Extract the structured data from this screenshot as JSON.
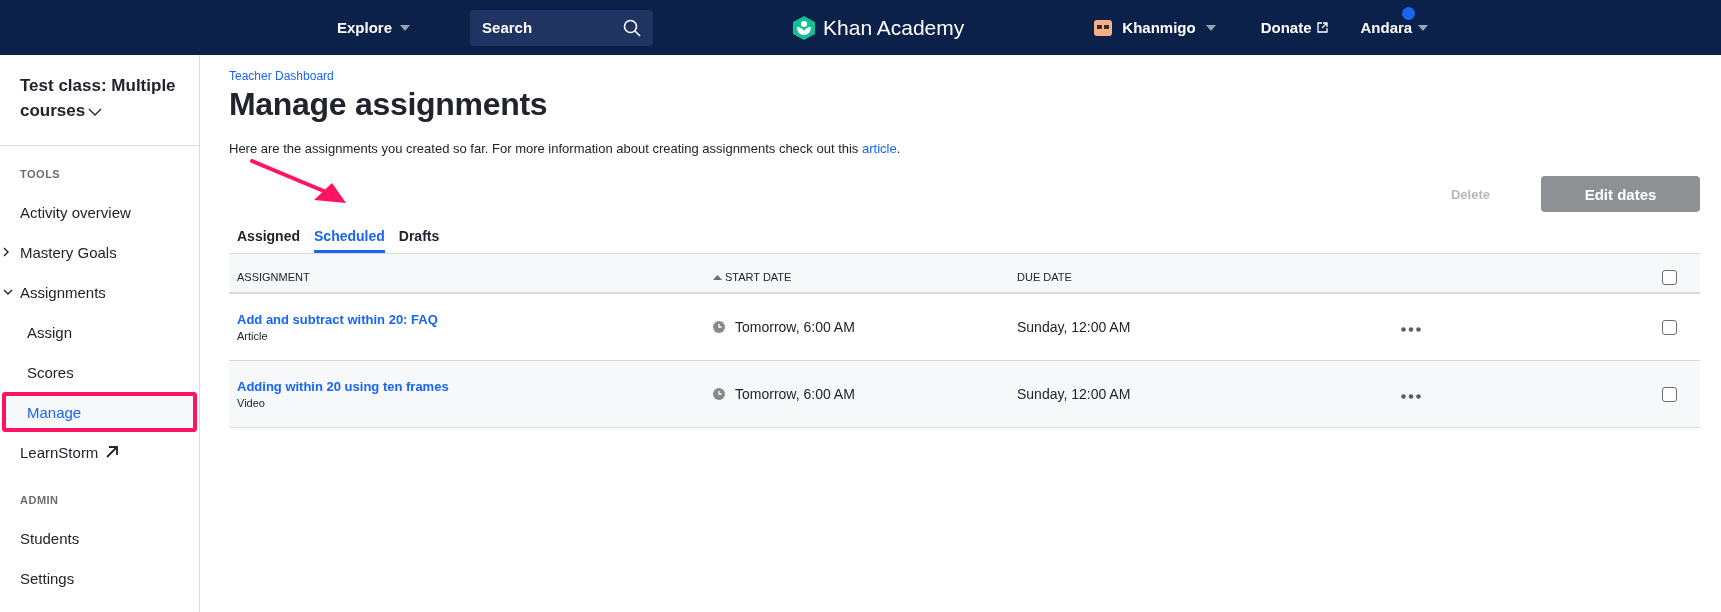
{
  "header": {
    "explore": "Explore",
    "search": {
      "placeholder": "Search"
    },
    "logo": "Khan Academy",
    "khanmigo": "Khanmigo",
    "donate": "Donate",
    "user": {
      "name": "Andara",
      "notification": true
    }
  },
  "sidebar": {
    "class_title": "Test class: Multiple courses",
    "sections": [
      {
        "heading": "TOOLS",
        "items": [
          {
            "label": "Activity overview",
            "kind": "plain",
            "selected": false,
            "highlighted": false
          },
          {
            "label": "Mastery Goals",
            "kind": "collapsible",
            "expanded": false,
            "selected": false,
            "highlighted": false
          },
          {
            "label": "Assignments",
            "kind": "collapsible",
            "expanded": true,
            "selected": false,
            "highlighted": false,
            "children": [
              {
                "label": "Assign",
                "kind": "plain",
                "selected": false,
                "highlighted": false
              },
              {
                "label": "Scores",
                "kind": "plain",
                "selected": false,
                "highlighted": false
              },
              {
                "label": "Manage",
                "kind": "plain",
                "selected": true,
                "highlighted": true
              }
            ]
          },
          {
            "label": "LearnStorm",
            "kind": "external",
            "selected": false,
            "highlighted": false
          }
        ]
      },
      {
        "heading": "ADMIN",
        "items": [
          {
            "label": "Students",
            "kind": "plain",
            "selected": false,
            "highlighted": false
          },
          {
            "label": "Settings",
            "kind": "plain",
            "selected": false,
            "highlighted": false
          }
        ]
      }
    ]
  },
  "main": {
    "breadcrumb": "Teacher Dashboard",
    "title": "Manage assignments",
    "description": {
      "text": "Here are the assignments you created so far. For more information about creating assignments check out this ",
      "link": "article",
      "end": "."
    },
    "buttons": [
      {
        "label": "Delete",
        "kind": "text",
        "disabled": true
      },
      {
        "label": "Edit dates",
        "kind": "primary",
        "disabled": true
      }
    ],
    "tabs": [
      {
        "label": "Assigned",
        "selected": false
      },
      {
        "label": "Scheduled",
        "selected": true
      },
      {
        "label": "Drafts",
        "selected": false
      }
    ],
    "table": {
      "columns": [
        {
          "label": "ASSIGNMENT",
          "sorted": false
        },
        {
          "label": "START DATE",
          "sorted": true
        },
        {
          "label": "DUE DATE",
          "sorted": false
        }
      ],
      "select_all_checked": false,
      "rows": [
        {
          "title": "Add and subtract within 20: FAQ",
          "type": "Article",
          "start": "Tomorrow, 6:00 AM",
          "due": "Sunday, 12:00 AM",
          "checked": false
        },
        {
          "title": "Adding within 20 using ten frames",
          "type": "Video",
          "start": "Tomorrow, 6:00 AM",
          "due": "Sunday, 12:00 AM",
          "checked": false
        }
      ]
    }
  }
}
